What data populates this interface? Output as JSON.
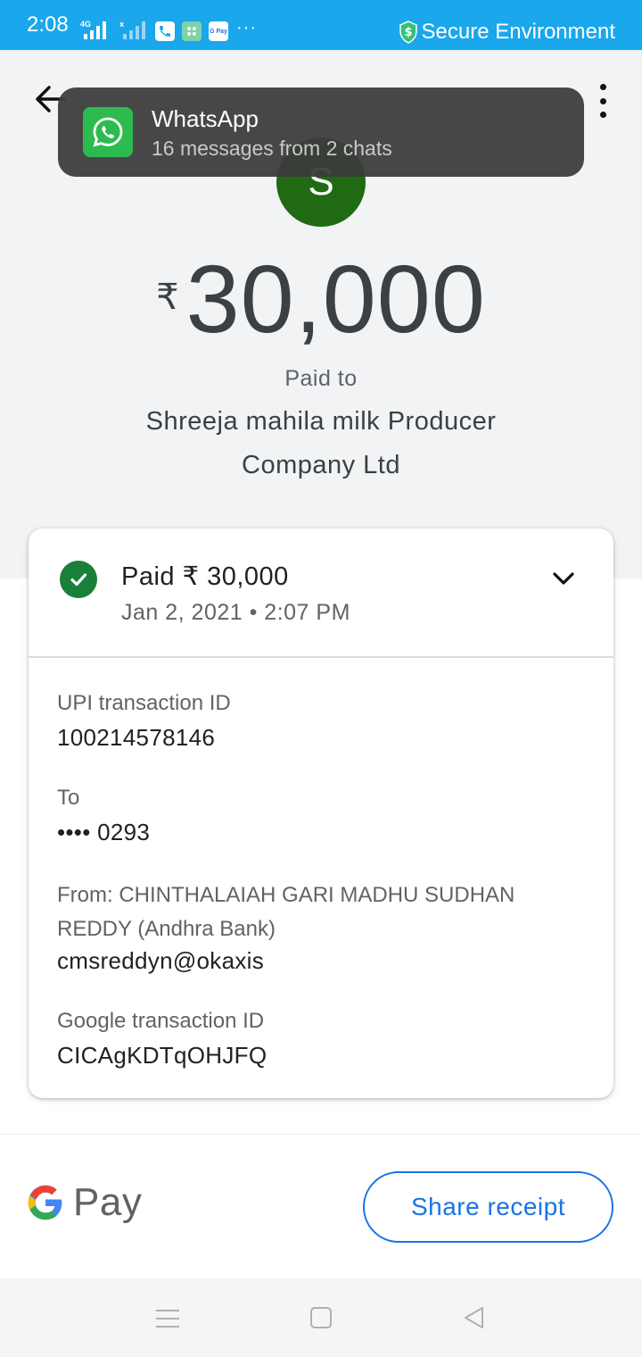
{
  "status_bar": {
    "time": "2:08",
    "network_tag_1": "4G",
    "network_tag_2": "x",
    "secure_label": "Secure Environment",
    "more": "···",
    "bg_color": "#1aa7ec"
  },
  "notification": {
    "app_name": "WhatsApp",
    "message": "16 messages from 2 chats",
    "icon": "whatsapp-icon"
  },
  "payee_avatar": {
    "initial": "S",
    "color": "#1f6a13"
  },
  "payment": {
    "currency_symbol": "₹",
    "amount": "30,000",
    "paid_to_label": "Paid to",
    "payee_name": "Shreeja mahila milk Producer Company Ltd"
  },
  "details_card": {
    "status": "Paid ₹ 30,000",
    "datetime": "Jan 2, 2021 • 2:07 PM",
    "upi_label": "UPI transaction ID",
    "upi_id": "100214578146",
    "to_label": "To",
    "to_account": "•••• 0293",
    "from_label": "From: CHINTHALAIAH GARI MADHU SUDHAN REDDY (Andhra Bank)",
    "from_vpa": "cmsreddyn@okaxis",
    "google_label": "Google transaction ID",
    "google_id": "CICAgKDTqOHJFQ",
    "status_color": "#188038"
  },
  "footer": {
    "logo_word": "Pay",
    "share_button": "Share receipt",
    "accent": "#1a73e8"
  }
}
